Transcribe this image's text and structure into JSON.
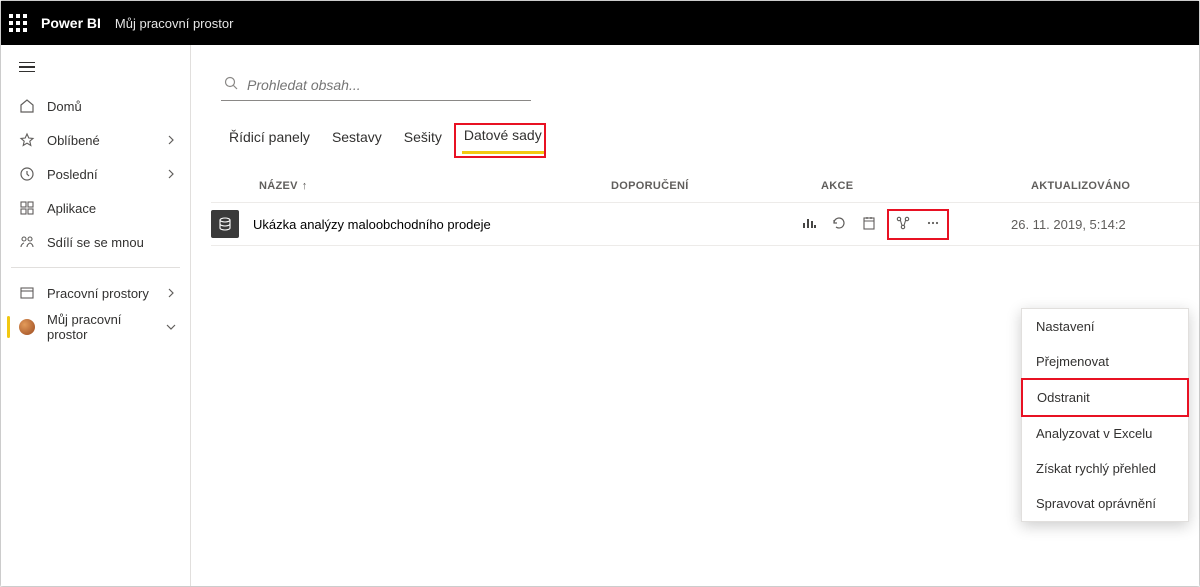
{
  "topbar": {
    "brand": "Power BI",
    "workspace": "Můj pracovní prostor"
  },
  "sidebar": {
    "items": [
      {
        "label": "Domů",
        "icon": "home"
      },
      {
        "label": "Oblíbené",
        "icon": "star",
        "expandable": true
      },
      {
        "label": "Poslední",
        "icon": "clock",
        "expandable": true
      },
      {
        "label": "Aplikace",
        "icon": "apps"
      },
      {
        "label": "Sdílí se se mnou",
        "icon": "share"
      }
    ],
    "workspaces_label": "Pracovní prostory",
    "current_label": "Můj pracovní prostor"
  },
  "search": {
    "placeholder": "Prohledat obsah..."
  },
  "tabs": [
    "Řídicí panely",
    "Sestavy",
    "Sešity",
    "Datové sady"
  ],
  "active_tab": "Datové sady",
  "columns": {
    "name": "NÁZEV",
    "endorsement": "DOPORUČENÍ",
    "actions": "AKCE",
    "updated": "AKTUALIZOVÁNO"
  },
  "rows": [
    {
      "name": "Ukázka analýzy maloobchodního prodeje",
      "updated": "26. 11. 2019, 5:14:2"
    }
  ],
  "context_menu": [
    "Nastavení",
    "Přejmenovat",
    "Odstranit",
    "Analyzovat v Excelu",
    "Získat rychlý přehled",
    "Spravovat oprávnění"
  ]
}
